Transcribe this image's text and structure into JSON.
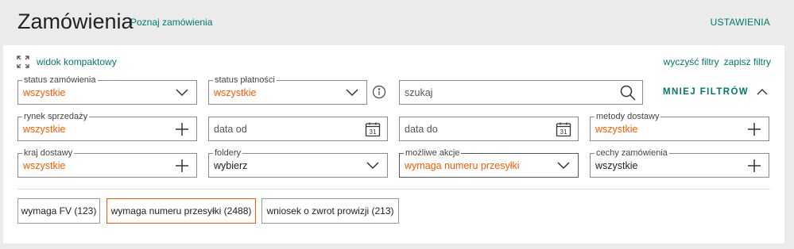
{
  "header": {
    "title": "Zamówienia",
    "learn_link": "Poznaj zamówienia",
    "settings_link": "USTAWIENIA"
  },
  "toolbar": {
    "compact_view": "widok kompaktowy",
    "clear_filters": "wyczyść filtry",
    "save_filters": "zapisz filtry",
    "less_filters": "MNIEJ FILTRÓW"
  },
  "filters": {
    "order_status": {
      "label": "status zamówienia",
      "value": "wszystkie"
    },
    "payment_status": {
      "label": "status płatności",
      "value": "wszystkie"
    },
    "search": {
      "placeholder": "szukaj"
    },
    "sales_market": {
      "label": "rynek sprzedaży",
      "value": "wszystkie"
    },
    "date_from": {
      "placeholder": "data od"
    },
    "date_to": {
      "placeholder": "data do"
    },
    "delivery_methods": {
      "label": "metody dostawy",
      "value": "wszystkie"
    },
    "delivery_country": {
      "label": "kraj dostawy",
      "value": "wszystkie"
    },
    "folders": {
      "label": "foldery",
      "value": "wybierz"
    },
    "possible_actions": {
      "label": "możliwe akcje",
      "value": "wymaga numeru przesyłki"
    },
    "order_features": {
      "label": "cechy zamówienia",
      "value": "wszystkie"
    }
  },
  "chips": [
    {
      "label": "wymaga FV (123)"
    },
    {
      "label": "wymaga numeru przesyłki (2488)"
    },
    {
      "label": "wniosek o zwrot prowizji (213)"
    }
  ],
  "colors": {
    "accent_green": "#00796b",
    "active_orange": "#ff5a00"
  },
  "icons": {
    "compact": "expand-corners-icon",
    "dropdown": "chevron-down-icon",
    "add": "plus-icon",
    "search": "search-icon",
    "calendar": "calendar-icon",
    "info": "info-icon",
    "collapse": "chevron-up-icon"
  },
  "calendar_day": "31"
}
